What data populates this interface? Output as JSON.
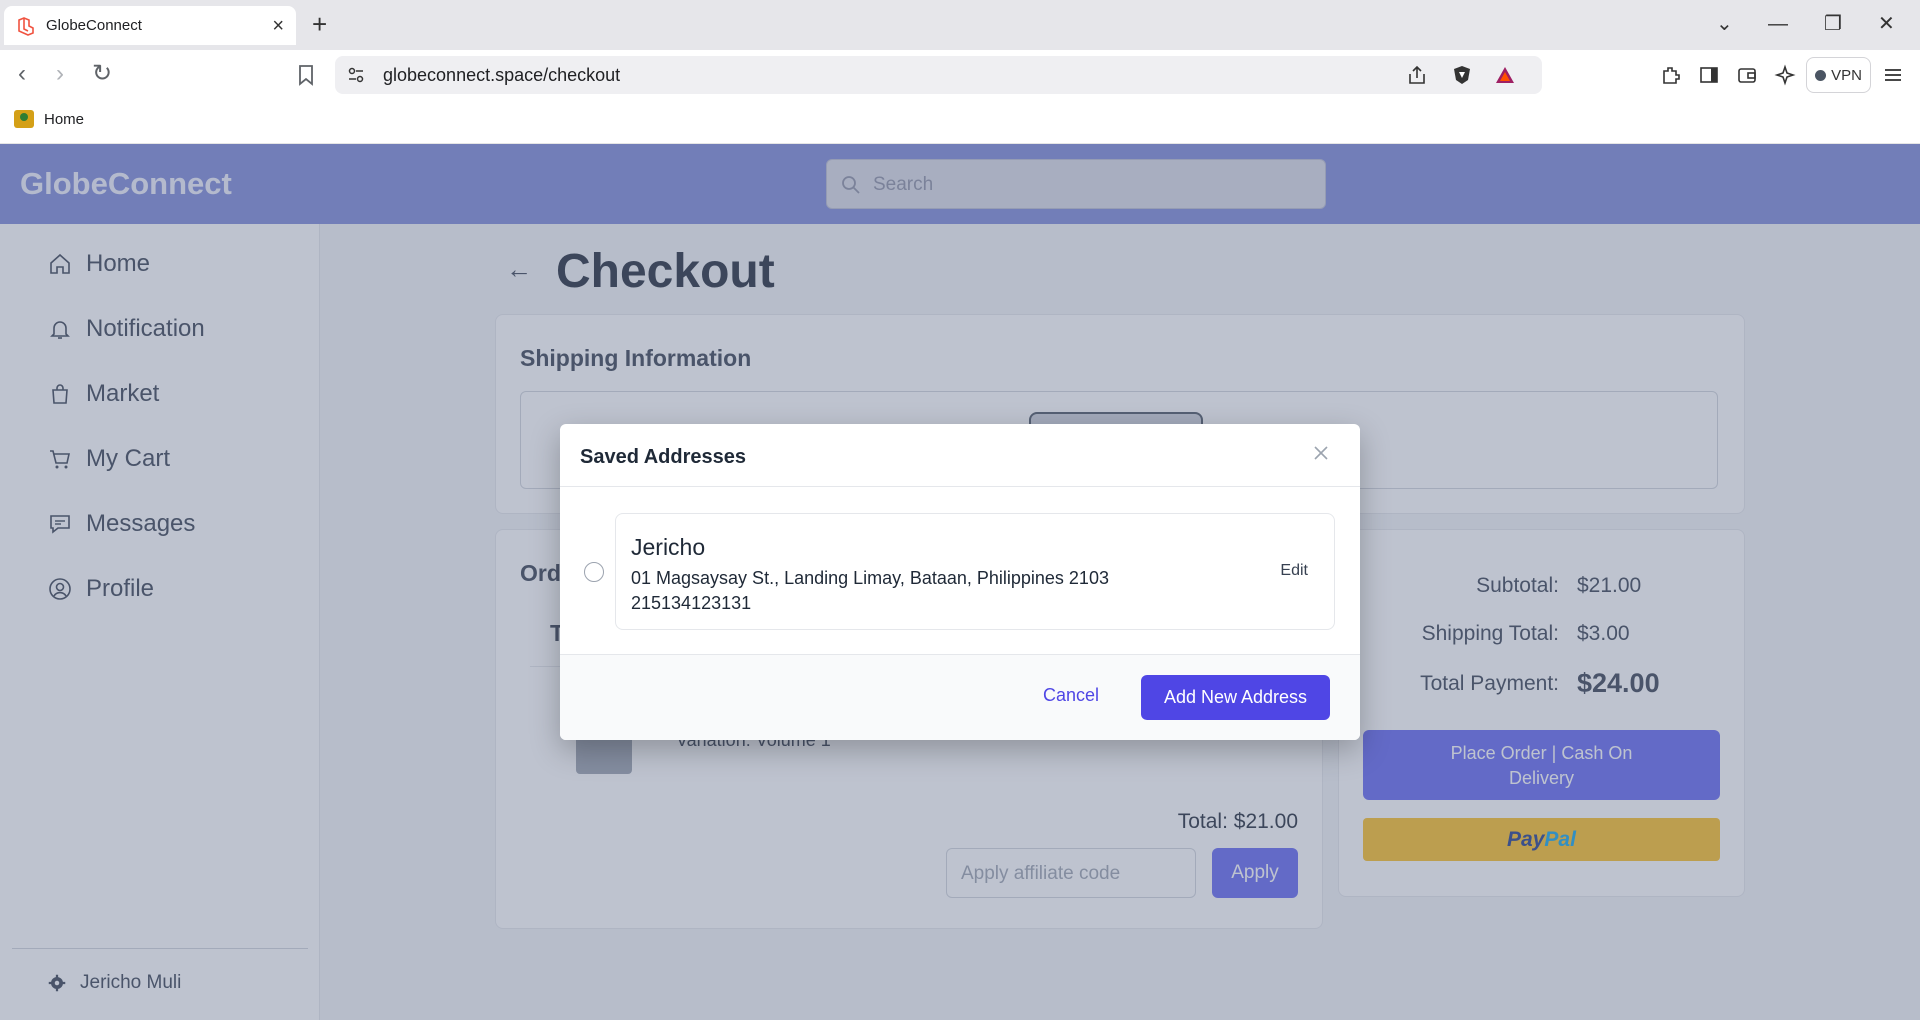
{
  "browser": {
    "tab_title": "GlobeConnect",
    "new_tab": "+",
    "url": "globeconnect.space/checkout",
    "vpn_label": "VPN",
    "bookmark_home": "Home"
  },
  "app": {
    "brand": "GlobeConnect",
    "search_placeholder": "Search",
    "sidebar": {
      "items": [
        {
          "label": "Home",
          "icon": "home-icon"
        },
        {
          "label": "Notification",
          "icon": "bell-icon"
        },
        {
          "label": "Market",
          "icon": "bag-icon"
        },
        {
          "label": "My Cart",
          "icon": "cart-icon"
        },
        {
          "label": "Messages",
          "icon": "chat-icon"
        },
        {
          "label": "Profile",
          "icon": "user-circle-icon"
        }
      ],
      "user_name": "Jericho Muli"
    }
  },
  "checkout": {
    "title": "Checkout",
    "shipping_title": "Shipping Information",
    "order_title": "Ord",
    "order_table_header": "T",
    "variation": "Variation: Volume 1",
    "order_total": "Total: $21.00",
    "affiliate_placeholder": "Apply affiliate code",
    "apply_label": "Apply",
    "summary": {
      "subtotal_label": "Subtotal:",
      "subtotal_value": "$21.00",
      "shipping_label": "Shipping Total:",
      "shipping_value": "$3.00",
      "total_label": "Total Payment:",
      "total_value": "$24.00"
    },
    "place_order_line1": "Place Order | Cash On",
    "place_order_line2": "Delivery",
    "paypal_pay": "Pay",
    "paypal_pal": "Pal"
  },
  "modal": {
    "title": "Saved Addresses",
    "address": {
      "name": "Jericho",
      "line": "01 Magsaysay St., Landing Limay, Bataan, Philippines 2103",
      "phone": "215134123131",
      "edit_label": "Edit"
    },
    "cancel_label": "Cancel",
    "add_label": "Add New Address"
  },
  "colors": {
    "header": "#7c88d7",
    "primary": "#4f46e5",
    "paypal_yellow": "#fbbf24"
  }
}
